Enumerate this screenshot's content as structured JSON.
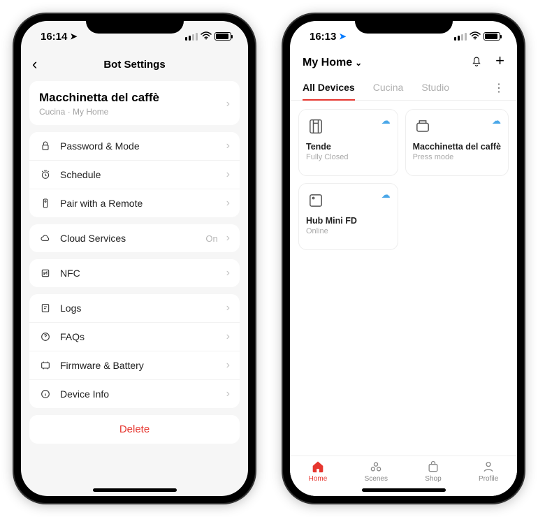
{
  "left": {
    "status_time": "16:14",
    "page_title": "Bot Settings",
    "device_name": "Macchinetta del caffè",
    "device_path": "Cucina · My Home",
    "groups": [
      {
        "rows": [
          {
            "icon": "lock",
            "label": "Password & Mode"
          },
          {
            "icon": "clock",
            "label": "Schedule"
          },
          {
            "icon": "remote",
            "label": "Pair with a Remote"
          }
        ]
      },
      {
        "rows": [
          {
            "icon": "cloud",
            "label": "Cloud Services",
            "value": "On"
          }
        ]
      },
      {
        "rows": [
          {
            "icon": "nfc",
            "label": "NFC"
          }
        ]
      },
      {
        "rows": [
          {
            "icon": "logs",
            "label": "Logs"
          },
          {
            "icon": "faq",
            "label": "FAQs"
          },
          {
            "icon": "firmware",
            "label": "Firmware & Battery"
          },
          {
            "icon": "info",
            "label": "Device Info"
          }
        ]
      }
    ],
    "delete_label": "Delete"
  },
  "right": {
    "status_time": "16:13",
    "home_label": "My Home",
    "tabs": [
      "All Devices",
      "Cucina",
      "Studio"
    ],
    "active_tab": 0,
    "devices": [
      {
        "name": "Tende",
        "status": "Fully Closed",
        "icon": "curtain"
      },
      {
        "name": "Macchinetta del caffè",
        "status": "Press mode",
        "icon": "bot"
      },
      {
        "name": "Hub Mini FD",
        "status": "Online",
        "icon": "hub"
      }
    ],
    "nav": [
      {
        "label": "Home",
        "icon": "home"
      },
      {
        "label": "Scenes",
        "icon": "scenes"
      },
      {
        "label": "Shop",
        "icon": "shop"
      },
      {
        "label": "Profile",
        "icon": "profile"
      }
    ],
    "active_nav": 0
  }
}
